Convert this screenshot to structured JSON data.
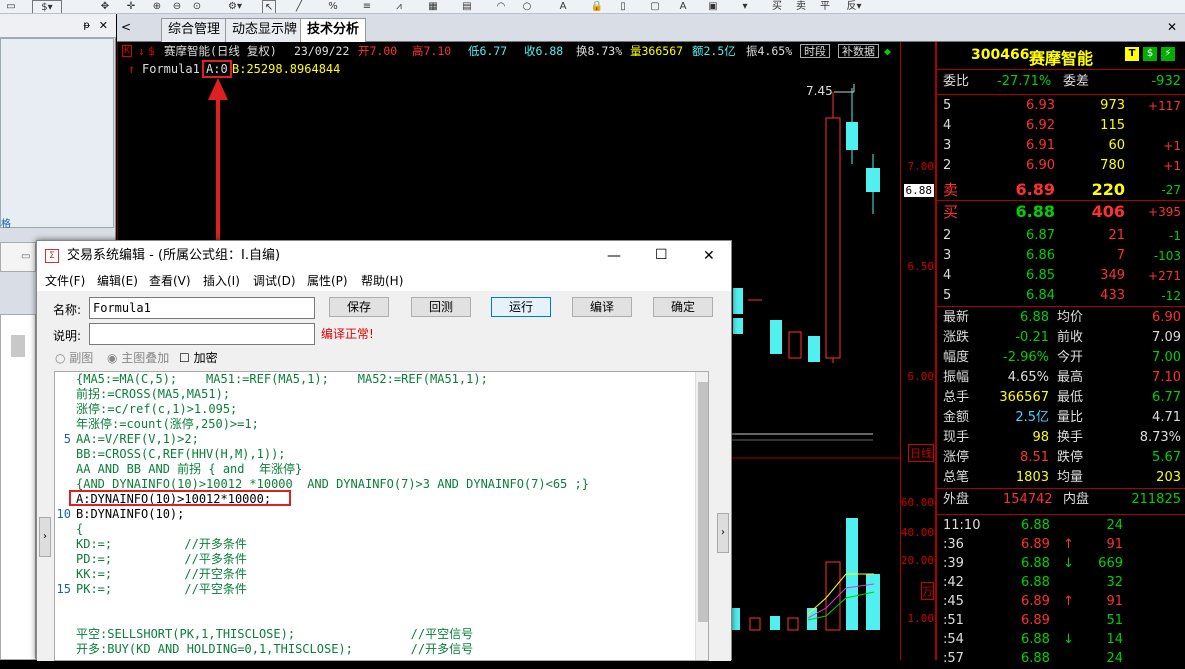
{
  "tabs": {
    "items": [
      "综合管理",
      "动态显示牌",
      "技术分析"
    ],
    "active": 2
  },
  "chart": {
    "header": {
      "name": "赛摩智能(日线 复权)",
      "date": "23/09/22",
      "open": "开7.00",
      "high": "高7.10",
      "low": "低6.77",
      "close": "收6.88",
      "turnover": "换8.73%",
      "volume": "量366567",
      "amount": "额2.5亿",
      "amplitude": "振4.65%",
      "btn_period": "时段",
      "btn_supp": "补数据"
    },
    "formula_line": {
      "name": "Formula1",
      "a": "A:0",
      "b": "B:25298.8964844"
    },
    "price_labels": [
      "7.00",
      "6.88",
      "6.50",
      "6.00"
    ],
    "vol_labels": [
      "60.00",
      "40.00",
      "20.00",
      "万",
      "1.00"
    ],
    "peak_label": "7.45",
    "weekline_label": "日线"
  },
  "quote": {
    "code": "300466",
    "name": "赛摩智能",
    "committee": {
      "ratio_label": "委比",
      "ratio": "-27.71%",
      "diff_label": "委差",
      "diff": "-932"
    },
    "sells": [
      {
        "lvl": "5",
        "price": "6.93",
        "vol": "973",
        "chg": "+117"
      },
      {
        "lvl": "4",
        "price": "6.92",
        "vol": "115",
        "chg": ""
      },
      {
        "lvl": "3",
        "price": "6.91",
        "vol": "60",
        "chg": "+1"
      },
      {
        "lvl": "2",
        "price": "6.90",
        "vol": "780",
        "chg": "+1"
      },
      {
        "lvl": "卖",
        "price": "6.89",
        "vol": "220",
        "chg": "-27"
      }
    ],
    "buys": [
      {
        "lvl": "买",
        "price": "6.88",
        "vol": "406",
        "chg": "+395"
      },
      {
        "lvl": "2",
        "price": "6.87",
        "vol": "21",
        "chg": "-1"
      },
      {
        "lvl": "3",
        "price": "6.86",
        "vol": "7",
        "chg": "-103"
      },
      {
        "lvl": "4",
        "price": "6.85",
        "vol": "349",
        "chg": "+271"
      },
      {
        "lvl": "5",
        "price": "6.84",
        "vol": "433",
        "chg": "-12"
      }
    ],
    "stats": [
      [
        "最新",
        "6.88",
        "均价",
        "6.90"
      ],
      [
        "涨跌",
        "-0.21",
        "前收",
        "7.09"
      ],
      [
        "幅度",
        "-2.96%",
        "今开",
        "7.00"
      ],
      [
        "振幅",
        "4.65%",
        "最高",
        "7.10"
      ],
      [
        "总手",
        "366567",
        "最低",
        "6.77"
      ],
      [
        "金额",
        "2.5亿",
        "量比",
        "4.71"
      ],
      [
        "现手",
        "98",
        "换手",
        "8.73%"
      ],
      [
        "涨停",
        "8.51",
        "跌停",
        "5.67"
      ],
      [
        "总笔",
        "1803",
        "均量",
        "203"
      ]
    ],
    "outer": {
      "label": "外盘",
      "value": "154742",
      "label2": "内盘",
      "value2": "211825"
    },
    "ticks": [
      {
        "t": "11:10",
        "p": "6.88",
        "d": "",
        "v": "24"
      },
      {
        "t": ":36",
        "p": "6.89",
        "d": "↑",
        "v": "91"
      },
      {
        "t": ":39",
        "p": "6.88",
        "d": "↓",
        "v": "669"
      },
      {
        "t": ":42",
        "p": "6.88",
        "d": "",
        "v": "32"
      },
      {
        "t": ":45",
        "p": "6.89",
        "d": "↑",
        "v": "91"
      },
      {
        "t": ":51",
        "p": "6.89",
        "d": "",
        "v": "51"
      },
      {
        "t": ":54",
        "p": "6.88",
        "d": "↓",
        "v": "14"
      },
      {
        "t": ":57",
        "p": "6.88",
        "d": "",
        "v": "24"
      }
    ]
  },
  "dialog": {
    "title": "交易系统编辑 - (所属公式组：I.自编)",
    "menu": [
      "文件(F)",
      "编辑(E)",
      "查看(V)",
      "插入(I)",
      "调试(D)",
      "属性(P)",
      "帮助(H)"
    ],
    "name_label": "名称:",
    "name_value": "Formula1",
    "desc_label": "说明:",
    "desc_value": "",
    "buttons": [
      "保存",
      "回测",
      "运行",
      "编译",
      "确定"
    ],
    "compile_status": "编译正常!",
    "radio_sub": "副图",
    "radio_main": "主图叠加",
    "check_encrypt": "加密",
    "line_numbers": [
      "5",
      "10",
      "15"
    ],
    "code_lines": [
      "{MA5:=MA(C,5);    MA51:=REF(MA5,1);    MA52:=REF(MA51,1);",
      "前拐:=CROSS(MA5,MA51);",
      "涨停:=c/ref(c,1)>1.095;",
      "年涨停:=count(涨停,250)>=1;",
      "AA:=V/REF(V,1)>2;",
      "BB:=CROSS(C,REF(HHV(H,M),1));",
      "AA AND BB AND 前拐 { and  年涨停}",
      "{AND DYNAINFO(10)>10012 *10000  AND DYNAINFO(7)>3 AND DYNAINFO(7)<65 ;}",
      "A:DYNAINFO(10)>10012*10000;",
      "B:DYNAINFO(10);",
      "{",
      "KD:=;          //开多条件",
      "PD:=;          //平多条件",
      "KK:=;          //开空条件",
      "PK:=;          //平空条件",
      "",
      "",
      "平空:SELLSHORT(PK,1,THISCLOSE);                //平空信号",
      "开多:BUY(KD AND HOLDING=0,1,THISCLOSE);        //开多信号"
    ]
  },
  "colors": {
    "up": "#ff3030",
    "down": "#50f0f0",
    "yellow": "#ffff00",
    "green": "#00d000",
    "axis": "#cc0000",
    "highlight": "#e02020"
  }
}
